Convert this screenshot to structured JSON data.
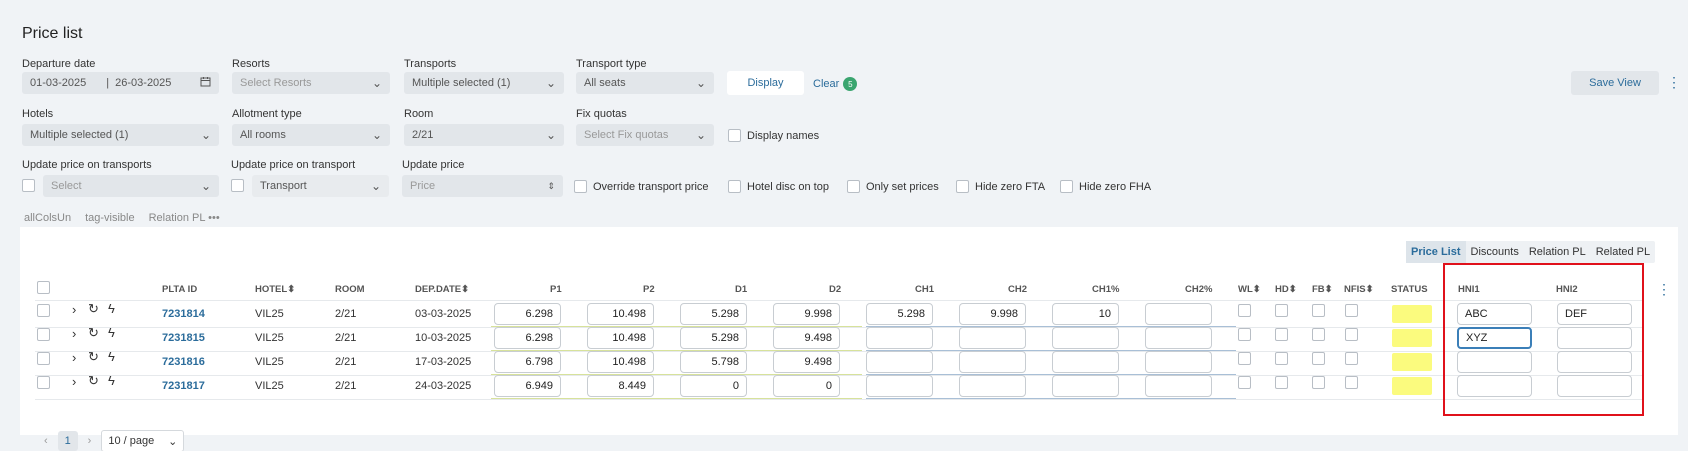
{
  "page": {
    "title": "Price list"
  },
  "filters": {
    "departure_date": {
      "label": "Departure date",
      "from": "01-03-2025",
      "sep": "|",
      "to": "26-03-2025"
    },
    "resorts": {
      "label": "Resorts",
      "placeholder": "Select Resorts"
    },
    "transports": {
      "label": "Transports",
      "value": "Multiple selected (1)"
    },
    "transport_type": {
      "label": "Transport type",
      "value": "All seats"
    },
    "display_button": "Display",
    "clear": {
      "label": "Clear",
      "count": "5"
    },
    "save_view": "Save View",
    "hotels": {
      "label": "Hotels",
      "value": "Multiple selected (1)"
    },
    "allotment_type": {
      "label": "Allotment type",
      "value": "All rooms"
    },
    "room": {
      "label": "Room",
      "value": "2/21"
    },
    "fix_quotas": {
      "label": "Fix quotas",
      "placeholder": "Select Fix quotas"
    },
    "display_names": "Display names",
    "update_price_on_transports": {
      "label": "Update price on transports",
      "placeholder": "Select"
    },
    "update_price_on_transport": {
      "label": "Update price on transport",
      "value": "Transport"
    },
    "update_price": {
      "label": "Update price",
      "placeholder": "Price"
    },
    "override_transport_price": "Override transport price",
    "hotel_disc_on_top": "Hotel disc on top",
    "only_set_prices": "Only set prices",
    "hide_zero_fta": "Hide zero FTA",
    "hide_zero_fha": "Hide zero FHA"
  },
  "tags": [
    "allColsUn",
    "tag-visible",
    "Relation PL",
    "•••"
  ],
  "tabs": [
    "Price List",
    "Discounts",
    "Relation PL",
    "Related PL"
  ],
  "columns": {
    "plta_id": "PLTA ID",
    "hotel": "HOTEL",
    "room": "ROOM",
    "dep_date": "DEP.DATE",
    "p1": "P1",
    "p2": "P2",
    "d1": "D1",
    "d2": "D2",
    "ch1": "CH1",
    "ch2": "CH2",
    "ch1p": "CH1%",
    "ch2p": "CH2%",
    "wl": "WL",
    "hd": "HD",
    "fb": "FB",
    "nfis": "NFIS",
    "status": "STATUS",
    "hni1": "HNI1",
    "hni2": "HNI2"
  },
  "rows": [
    {
      "id": "7231814",
      "hotel": "VIL25",
      "room": "2/21",
      "date": "03-03-2025",
      "p1": "6.298",
      "p2": "10.498",
      "d1": "5.298",
      "d2": "9.998",
      "ch1": "5.298",
      "ch2": "9.998",
      "ch1p": "10",
      "ch2p": "",
      "hni1": "ABC",
      "hni2": "DEF"
    },
    {
      "id": "7231815",
      "hotel": "VIL25",
      "room": "2/21",
      "date": "10-03-2025",
      "p1": "6.298",
      "p2": "10.498",
      "d1": "5.298",
      "d2": "9.498",
      "ch1": "",
      "ch2": "",
      "ch1p": "",
      "ch2p": "",
      "hni1": "XYZ",
      "hni2": ""
    },
    {
      "id": "7231816",
      "hotel": "VIL25",
      "room": "2/21",
      "date": "17-03-2025",
      "p1": "6.798",
      "p2": "10.498",
      "d1": "5.798",
      "d2": "9.498",
      "ch1": "",
      "ch2": "",
      "ch1p": "",
      "ch2p": "",
      "hni1": "",
      "hni2": ""
    },
    {
      "id": "7231817",
      "hotel": "VIL25",
      "room": "2/21",
      "date": "24-03-2025",
      "p1": "6.949",
      "p2": "8.449",
      "d1": "0",
      "d2": "0",
      "ch1": "",
      "ch2": "",
      "ch1p": "",
      "ch2p": "",
      "hni1": "",
      "hni2": ""
    }
  ],
  "pagination": {
    "prev": "‹",
    "current": "1",
    "next": "›",
    "page_size": "10 / page"
  },
  "colors": {
    "accent": "#2b6c9b",
    "status_yellow": "#fbfb7e",
    "highlight_red": "#e0111b",
    "badge_green": "#3aa56f"
  },
  "icons": [
    "calendar-icon",
    "chevron-down-icon",
    "more-vertical-icon",
    "expand-icon",
    "refresh-icon",
    "bolt-icon",
    "sort-icon"
  ]
}
